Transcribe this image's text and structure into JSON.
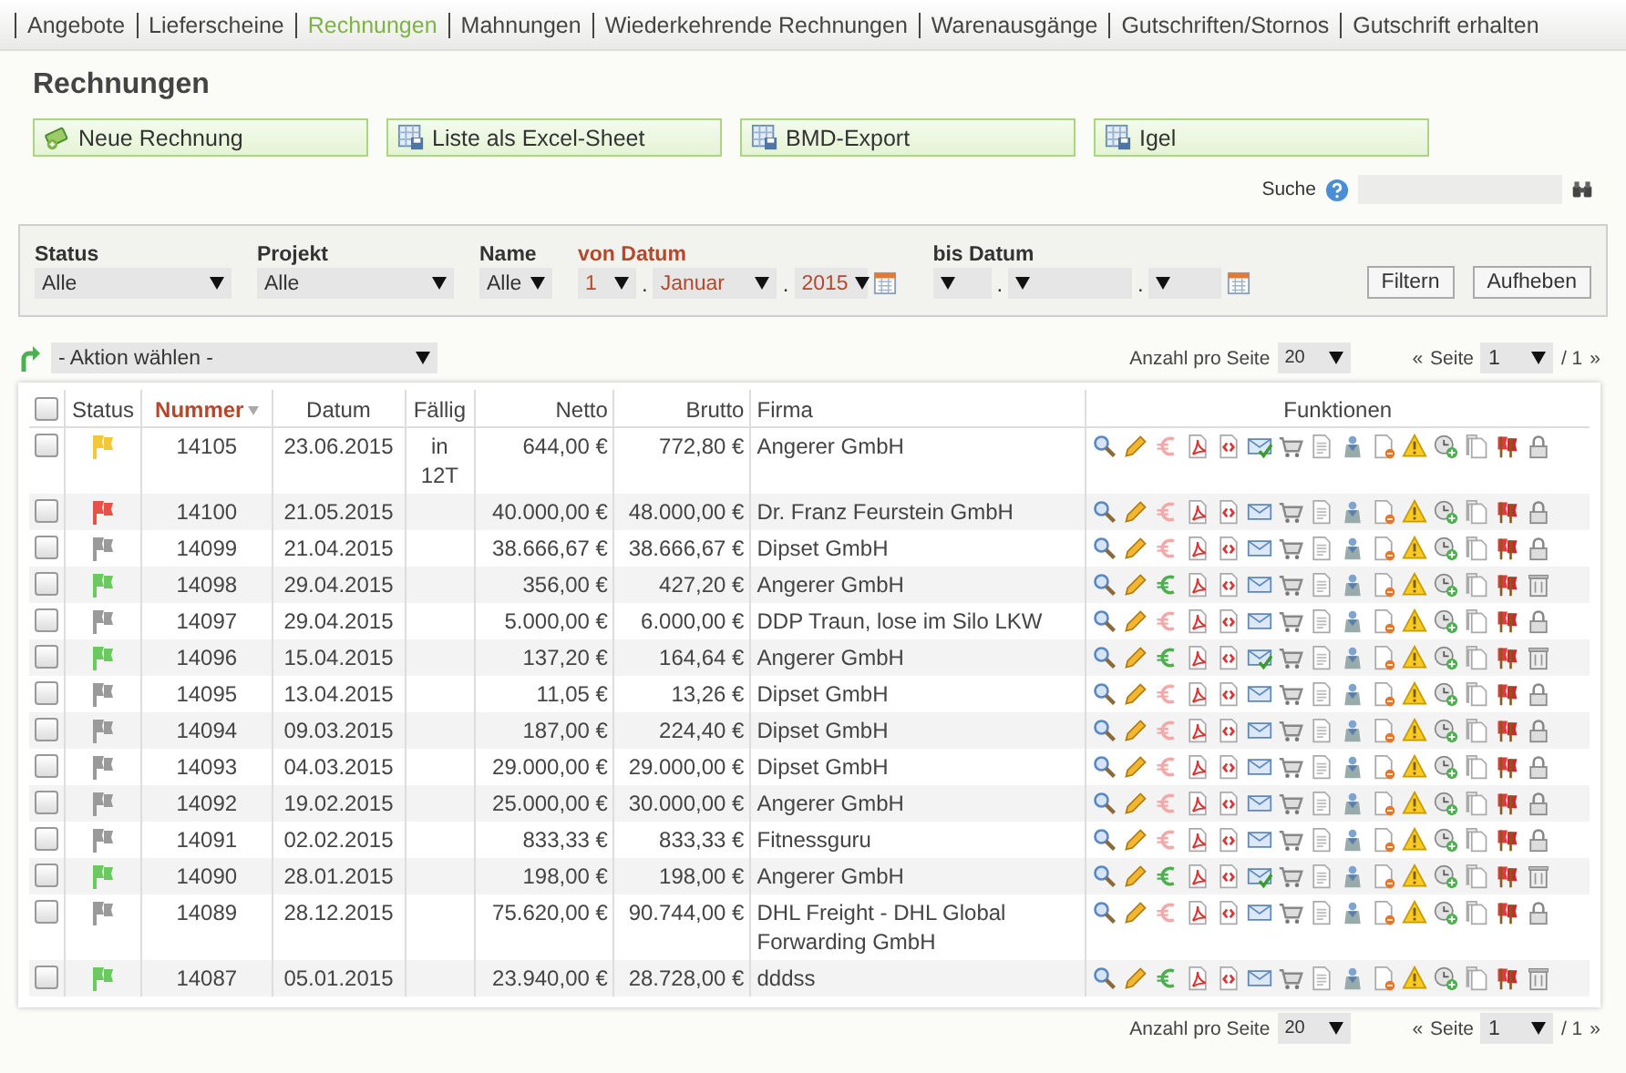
{
  "tabs": [
    {
      "label": "Angebote",
      "selected": false
    },
    {
      "label": "Lieferscheine",
      "selected": false
    },
    {
      "label": "Rechnungen",
      "selected": true
    },
    {
      "label": "Mahnungen",
      "selected": false
    },
    {
      "label": "Wiederkehrende Rechnungen",
      "selected": false
    },
    {
      "label": "Warenausgänge",
      "selected": false
    },
    {
      "label": "Gutschriften/Stornos",
      "selected": false
    },
    {
      "label": "Gutschrift erhalten",
      "selected": false
    }
  ],
  "title": "Rechnungen",
  "buttons": [
    {
      "label": "Neue Rechnung",
      "kind": "create"
    },
    {
      "label": "Liste als Excel-Sheet",
      "kind": "export"
    },
    {
      "label": "BMD-Export",
      "kind": "export"
    },
    {
      "label": "Igel",
      "kind": "export"
    }
  ],
  "search": {
    "label": "Suche"
  },
  "filters": {
    "status": {
      "label": "Status",
      "value": "Alle"
    },
    "projekt": {
      "label": "Projekt",
      "value": "Alle"
    },
    "name": {
      "label": "Name",
      "value": "Alle"
    },
    "von_datum": {
      "label": "von Datum",
      "active": true,
      "day": "1",
      "month": "Januar",
      "year": "2015",
      "separator": "."
    },
    "bis_datum": {
      "label": "bis Datum",
      "active": false,
      "separator": "."
    },
    "buttons": [
      "Filtern",
      "Aufheben"
    ]
  },
  "action_select": {
    "value": "- Aktion wählen -"
  },
  "pagers": [
    {
      "label": "Anzahl pro Seite",
      "per_page": "20",
      "prev": "«",
      "page_label": "Seite",
      "page": "1",
      "total": "/ 1",
      "next": "»"
    },
    {
      "label": "Anzahl pro Seite",
      "per_page": "20",
      "prev": "«",
      "page_label": "Seite",
      "page": "1",
      "total": "/ 1",
      "next": "»"
    }
  ],
  "table": {
    "select_all": {
      "checked": false
    },
    "columns": [
      {
        "label": "Status",
        "sorted": false
      },
      {
        "label": "Nummer",
        "sorted": true
      },
      {
        "label": "Datum",
        "sorted": false
      },
      {
        "label": "Fällig",
        "sorted": false
      },
      {
        "label": "Netto",
        "sorted": false
      },
      {
        "label": "Brutto",
        "sorted": false
      },
      {
        "label": "Firma",
        "sorted": false
      },
      {
        "label": "Funktionen",
        "sorted": false
      }
    ],
    "rows": [
      {
        "checked": false,
        "color": "#f0c838",
        "nummer": "14105",
        "datum": "23.06.2015",
        "faellig": "in 12T",
        "netto": "644,00 €",
        "brutto": "772,80 €",
        "firma": "Angerer GmbH",
        "paid": false,
        "sent": true,
        "deletable": false
      },
      {
        "checked": false,
        "color": "#e8504a",
        "nummer": "14100",
        "datum": "21.05.2015",
        "netto": "40.000,00 €",
        "brutto": "48.000,00 €",
        "firma": "Dr. Franz Feurstein GmbH",
        "paid": false,
        "sent": false,
        "deletable": false
      },
      {
        "checked": false,
        "color": "#9a9a9a",
        "nummer": "14099",
        "datum": "21.04.2015",
        "netto": "38.666,67 €",
        "brutto": "38.666,67 €",
        "firma": "Dipset GmbH",
        "paid": false,
        "sent": false,
        "deletable": false
      },
      {
        "checked": false,
        "color": "#6cc860",
        "nummer": "14098",
        "datum": "29.04.2015",
        "netto": "356,00 €",
        "brutto": "427,20 €",
        "firma": "Angerer GmbH",
        "paid": true,
        "sent": false,
        "deletable": true
      },
      {
        "checked": false,
        "color": "#9a9a9a",
        "nummer": "14097",
        "datum": "29.04.2015",
        "netto": "5.000,00 €",
        "brutto": "6.000,00 €",
        "firma": "DDP Traun, lose im Silo LKW",
        "paid": false,
        "sent": false,
        "deletable": false
      },
      {
        "checked": false,
        "color": "#6cc860",
        "nummer": "14096",
        "datum": "15.04.2015",
        "netto": "137,20 €",
        "brutto": "164,64 €",
        "firma": "Angerer GmbH",
        "paid": true,
        "sent": true,
        "deletable": true
      },
      {
        "checked": false,
        "color": "#9a9a9a",
        "nummer": "14095",
        "datum": "13.04.2015",
        "netto": "11,05 €",
        "brutto": "13,26 €",
        "firma": "Dipset GmbH",
        "paid": false,
        "sent": false,
        "deletable": false
      },
      {
        "checked": false,
        "color": "#9a9a9a",
        "nummer": "14094",
        "datum": "09.03.2015",
        "netto": "187,00 €",
        "brutto": "224,40 €",
        "firma": "Dipset GmbH",
        "paid": false,
        "sent": false,
        "deletable": false
      },
      {
        "checked": false,
        "color": "#9a9a9a",
        "nummer": "14093",
        "datum": "04.03.2015",
        "netto": "29.000,00 €",
        "brutto": "29.000,00 €",
        "firma": "Dipset GmbH",
        "paid": false,
        "sent": false,
        "deletable": false
      },
      {
        "checked": false,
        "color": "#9a9a9a",
        "nummer": "14092",
        "datum": "19.02.2015",
        "netto": "25.000,00 €",
        "brutto": "30.000,00 €",
        "firma": "Angerer GmbH",
        "paid": false,
        "sent": false,
        "deletable": false
      },
      {
        "checked": false,
        "color": "#9a9a9a",
        "nummer": "14091",
        "datum": "02.02.2015",
        "netto": "833,33 €",
        "brutto": "833,33 €",
        "firma": "Fitnessguru",
        "paid": false,
        "sent": false,
        "deletable": false
      },
      {
        "checked": false,
        "color": "#6cc860",
        "nummer": "14090",
        "datum": "28.01.2015",
        "netto": "198,00 €",
        "brutto": "198,00 €",
        "firma": "Angerer GmbH",
        "paid": true,
        "sent": true,
        "deletable": true
      },
      {
        "checked": false,
        "color": "#9a9a9a",
        "nummer": "14089",
        "datum": "28.12.2015",
        "netto": "75.620,00 €",
        "brutto": "90.744,00 €",
        "firma": "DHL Freight - DHL Global Forwarding GmbH",
        "paid": false,
        "sent": false,
        "deletable": false
      },
      {
        "checked": false,
        "color": "#6cc860",
        "nummer": "14087",
        "datum": "05.01.2015",
        "netto": "23.940,00 €",
        "brutto": "28.728,00 €",
        "firma": "dddss",
        "paid": true,
        "sent": false,
        "deletable": true
      }
    ]
  }
}
